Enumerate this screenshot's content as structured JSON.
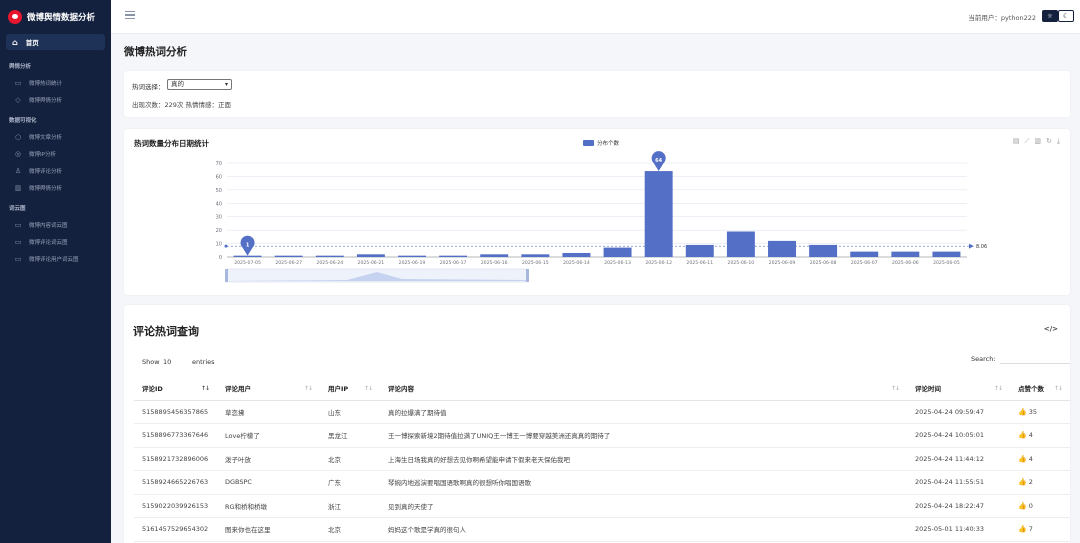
{
  "app": {
    "title": "微博舆情数据分析"
  },
  "sidebar": {
    "home": "首页",
    "groups": [
      {
        "label": "舆情分析",
        "items": [
          {
            "label": "微博热词统计",
            "icon": "briefcase-icon"
          },
          {
            "label": "微博舆情分析",
            "icon": "tag-icon"
          }
        ]
      },
      {
        "label": "数据可视化",
        "items": [
          {
            "label": "微博文章分析",
            "icon": "comment-icon"
          },
          {
            "label": "微博IP分析",
            "icon": "globe-icon"
          },
          {
            "label": "微博评论分析",
            "icon": "users-icon"
          },
          {
            "label": "微博舆情分析",
            "icon": "bar-chart-icon"
          }
        ]
      },
      {
        "label": "词云图",
        "items": [
          {
            "label": "微博内容词云图",
            "icon": "monitor-icon"
          },
          {
            "label": "微博评论词云图",
            "icon": "monitor-icon"
          },
          {
            "label": "微博评论用户词云图",
            "icon": "monitor-icon"
          }
        ]
      }
    ]
  },
  "topbar": {
    "user_label": "当前用户：python222",
    "toggle_label": "☼"
  },
  "page": {
    "title": "微博热词分析"
  },
  "selector": {
    "label": "热词选择：",
    "value": "真的",
    "stats": "出现次数：229次   热情情感：正面"
  },
  "chart": {
    "title": "热词数量分布日期统计",
    "legend": "分布个数",
    "colors": {
      "bar": "#5470c6",
      "axis": "#6e7079",
      "mark": "#5470c6",
      "grid": "#e0e6f1"
    }
  },
  "chart_data": {
    "type": "bar",
    "categories": [
      "2025-07-05",
      "2025-06-27",
      "2025-06-24",
      "2025-06-21",
      "2025-06-19",
      "2025-06-17",
      "2025-06-16",
      "2025-06-15",
      "2025-06-14",
      "2025-06-13",
      "2025-06-12",
      "2025-06-11",
      "2025-06-10",
      "2025-06-09",
      "2025-06-08",
      "2025-06-07",
      "2025-06-06",
      "2025-06-05"
    ],
    "series": [
      {
        "name": "分布个数",
        "values": [
          1,
          1,
          1,
          2,
          1,
          1,
          2,
          2,
          3,
          7,
          64,
          9,
          19,
          12,
          9,
          4,
          4,
          4
        ]
      }
    ],
    "yticks": [
      0,
      10,
      20,
      30,
      40,
      50,
      60,
      70
    ],
    "ylim": [
      0,
      70
    ],
    "mark_points": {
      "max": 64,
      "min": 1
    },
    "mark_line_average": 8.06,
    "legend_position": "top-center",
    "grid": true,
    "dataZoom": true
  },
  "table": {
    "title": "评论热词查询",
    "show_label": "Show",
    "show_value": "10",
    "entries_label": "entries",
    "search_label": "Search:",
    "headers": [
      "评论ID",
      "评论用户",
      "用户IP",
      "评论内容",
      "评论时间",
      "点赞个数"
    ],
    "rows": [
      [
        "5158895456357865",
        "草恋拂",
        "山东",
        "真的拉爆满了期待值",
        "2025-04-24 09:59:47",
        "35"
      ],
      [
        "5158896773367646",
        "Love柠檬了",
        "黑龙江",
        "王一博探索新境2期待值拉满了UNIQ王一博王一博要穿越美洲还真真的期待了",
        "2025-04-24 10:05:01",
        "4"
      ],
      [
        "5158921732896006",
        "泼子叶放",
        "北京",
        "上海生日场我真的好想去见你啊希望能申请下假来老天保佑我吧",
        "2025-04-24 11:44:12",
        "4"
      ],
      [
        "5158924665226763",
        "DGBSPC",
        "广东",
        "琴婉内地巡演要唱国语歌啊真的很想听你唱国语歌",
        "2025-04-24 11:55:51",
        "2"
      ],
      [
        "5159022039926153",
        "RG和桥和桥墩",
        "浙江",
        "见到真的天使了",
        "2025-04-24 18:22:47",
        "0"
      ],
      [
        "5161457529654302",
        "图来你也在这里",
        "北京",
        "妈妈这个歌是学真的很句人",
        "2025-05-01 11:40:33",
        "7"
      ]
    ]
  }
}
